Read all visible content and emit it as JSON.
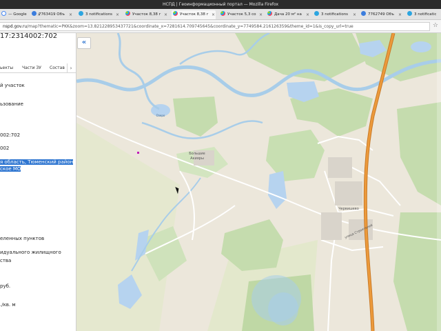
{
  "window": {
    "title": "НСПД | Геоинформационный портал — Mozilla Firefox"
  },
  "tabs": [
    {
      "label": "— Google",
      "icon": "google-icon"
    },
    {
      "label": "7763419 Объ",
      "icon": "globe-icon"
    },
    {
      "label": "3 notifications",
      "icon": "telegram-icon"
    },
    {
      "label": "Участок 8,38 г",
      "icon": "avito-icon"
    },
    {
      "label": "Участок 8,38 г",
      "icon": "avito-icon"
    },
    {
      "label": "Участок 5,3 со",
      "icon": "avito-icon"
    },
    {
      "label": "Дача 20 м² на",
      "icon": "avito-icon"
    },
    {
      "label": "3 notifications",
      "icon": "telegram-icon"
    },
    {
      "label": "7762749 Объ",
      "icon": "globe-icon"
    },
    {
      "label": "3 notificatic",
      "icon": "telegram-icon"
    }
  ],
  "address": {
    "host": "nspd.gov.ru",
    "path": "/map?thematic=PKK&zoom=13.821228953437721&coordinate_x=7281614.709745645&coordinate_y=7749584.216126359&theme_id=1&is_copy_url=true"
  },
  "sidebar": {
    "cad_number": "17:2314002:702",
    "tabs": [
      "ьекты",
      "Части ЗУ",
      "Состав"
    ],
    "tab_arrow": "›",
    "lines": [
      "й участок",
      "ьзование",
      "002:702",
      "002",
      "я область, Тюменский район,",
      "ское МО",
      "еленных пунктов",
      "идуального жилищного",
      "ства",
      " руб.",
      "./кв. м"
    ]
  },
  "map": {
    "collapse_label": "«",
    "labels": {
      "lake": "Озеро",
      "village1_a": "Большие",
      "village1_b": "Акияры",
      "town": "Червишево",
      "street": "улица Строителей"
    }
  },
  "colors": {
    "map_bg": "#ece7db",
    "forest": "#c5dcae",
    "water": "#b6d3ef",
    "river": "#a8cde9",
    "road_major": "#ec9a3b",
    "road_minor": "#ffffff",
    "selection": "#2f76d1"
  }
}
